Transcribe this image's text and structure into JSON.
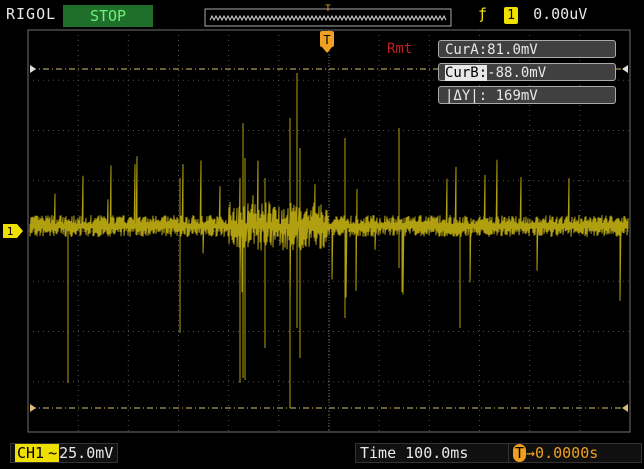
{
  "header": {
    "brand": "RIGOL",
    "run_state": "STOP",
    "trigger_edge_symbol": "ƒ",
    "trigger_source": "1",
    "trigger_level": "0.00uV"
  },
  "markers": {
    "trigger_marker": "T",
    "channel_marker": "1"
  },
  "remote_indicator": "Rmt",
  "cursors": {
    "cur_a_label": "CurA:",
    "cur_a_value": "81.0mV",
    "cur_b_label": "CurB:",
    "cur_b_value": "-88.0mV",
    "delta_label": "|ΔY|:",
    "delta_value": "169mV"
  },
  "footer": {
    "channel_label": "CH1",
    "coupling_symbol": "~",
    "volts_per_div": "25.0mV",
    "time_label": "Time",
    "time_per_div": "100.0ms",
    "trigger_pos_symbol": "T",
    "trigger_offset": "→0.0000s"
  },
  "colors": {
    "trace": "#b0a010",
    "grid": "#505050",
    "cursor_line": "#d8c070",
    "run_state_bg": "#1f6f2a",
    "remote": "#c02020"
  }
}
